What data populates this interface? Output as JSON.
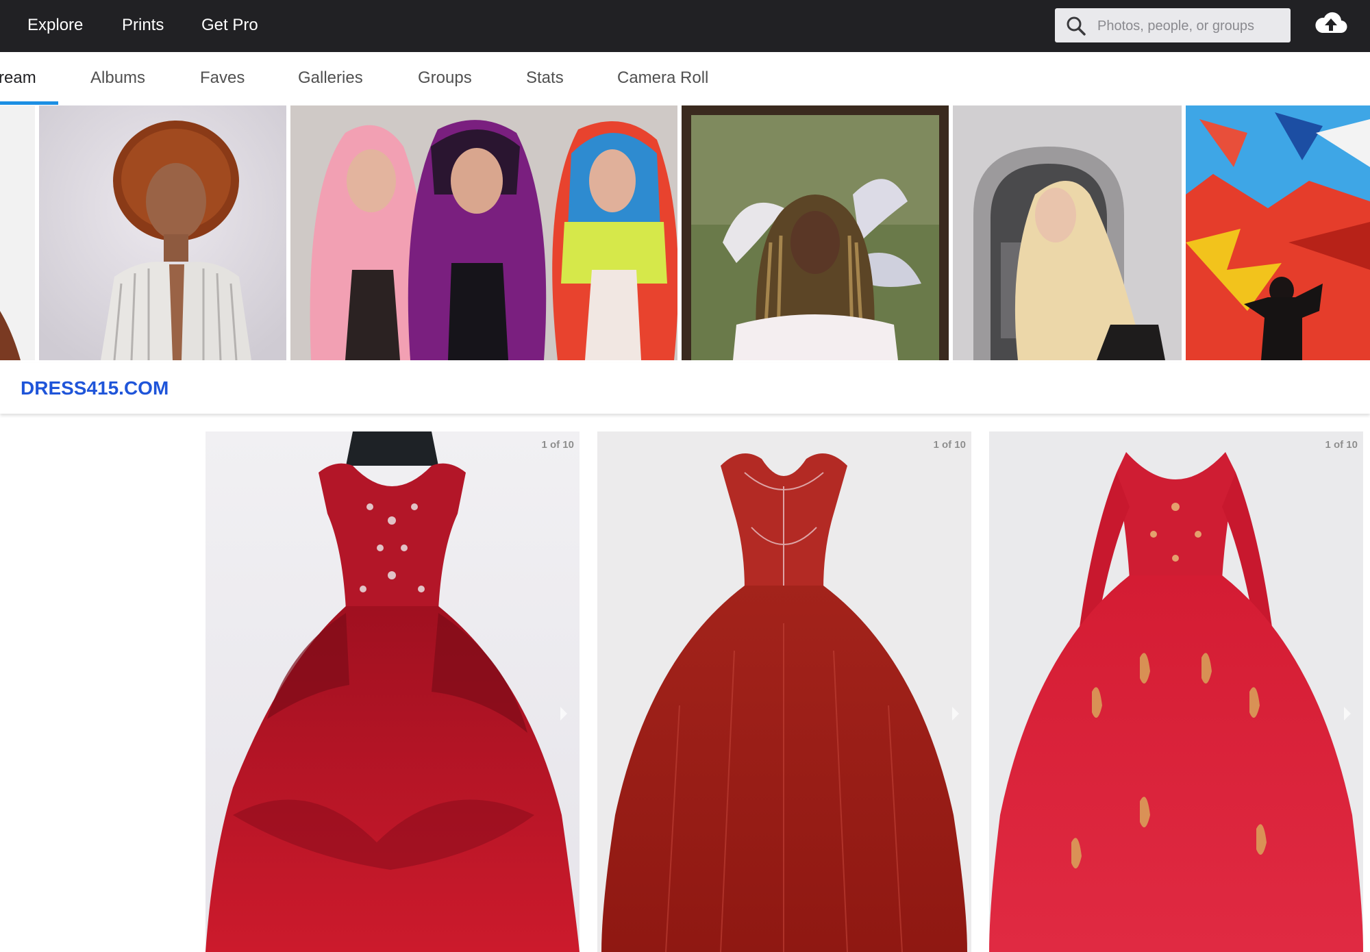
{
  "topnav": {
    "links": [
      {
        "label": "Explore"
      },
      {
        "label": "Prints"
      },
      {
        "label": "Get Pro"
      }
    ],
    "search_placeholder": "Photos, people, or groups",
    "upload_icon": "cloud-upload-icon"
  },
  "subnav": {
    "tabs": [
      {
        "label": "ream",
        "active": true
      },
      {
        "label": "Albums"
      },
      {
        "label": "Faves"
      },
      {
        "label": "Galleries"
      },
      {
        "label": "Groups"
      },
      {
        "label": "Stats"
      },
      {
        "label": "Camera Roll"
      }
    ],
    "active_color": "#1c8fe3"
  },
  "collection": {
    "title": "DRESS415.COM",
    "title_color": "#1f55d9"
  },
  "cards": [
    {
      "counter": "1 of 10"
    },
    {
      "counter": "1 of 10"
    },
    {
      "counter": "1 of 10"
    }
  ],
  "colors": {
    "topbar": "#212124"
  }
}
